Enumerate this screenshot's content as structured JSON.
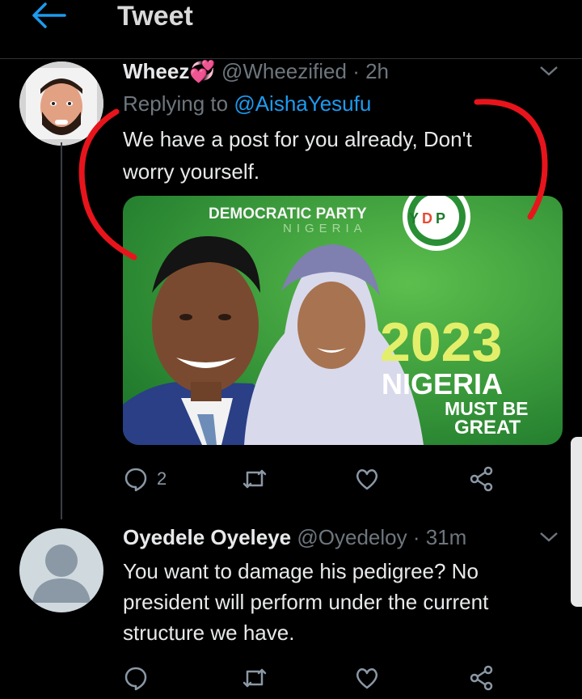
{
  "header": {
    "title": "Tweet"
  },
  "tweets": [
    {
      "name": "Wheez",
      "emoji": "💞",
      "handle": "@Wheezified",
      "time": "· 2h",
      "replying_prefix": "Replying to",
      "replying_to": "@AishaYesufu",
      "text_lines": [
        "We have a post for you already, Don't",
        "worry yourself."
      ],
      "media": {
        "party_line": "DEMOCRATIC PARTY",
        "country_line": "NIGERIA",
        "logo_letters": [
          "Y",
          "D",
          "P"
        ],
        "year": "2023",
        "slogan_1": "NIGERIA",
        "slogan_2": "MUST BE",
        "slogan_3": "GREAT"
      },
      "reply_count": "2"
    },
    {
      "name": "Oyedele Oyeleye",
      "handle": "@Oyedeloy",
      "time": "· 31m",
      "text_lines": [
        "You want to damage his pedigree? No",
        "president will perform under the current",
        "structure we have."
      ]
    }
  ],
  "colors": {
    "accent": "#1d9bf0",
    "background": "#000000",
    "annotation": "#e8141c",
    "poster_green": "#3a9a35"
  }
}
